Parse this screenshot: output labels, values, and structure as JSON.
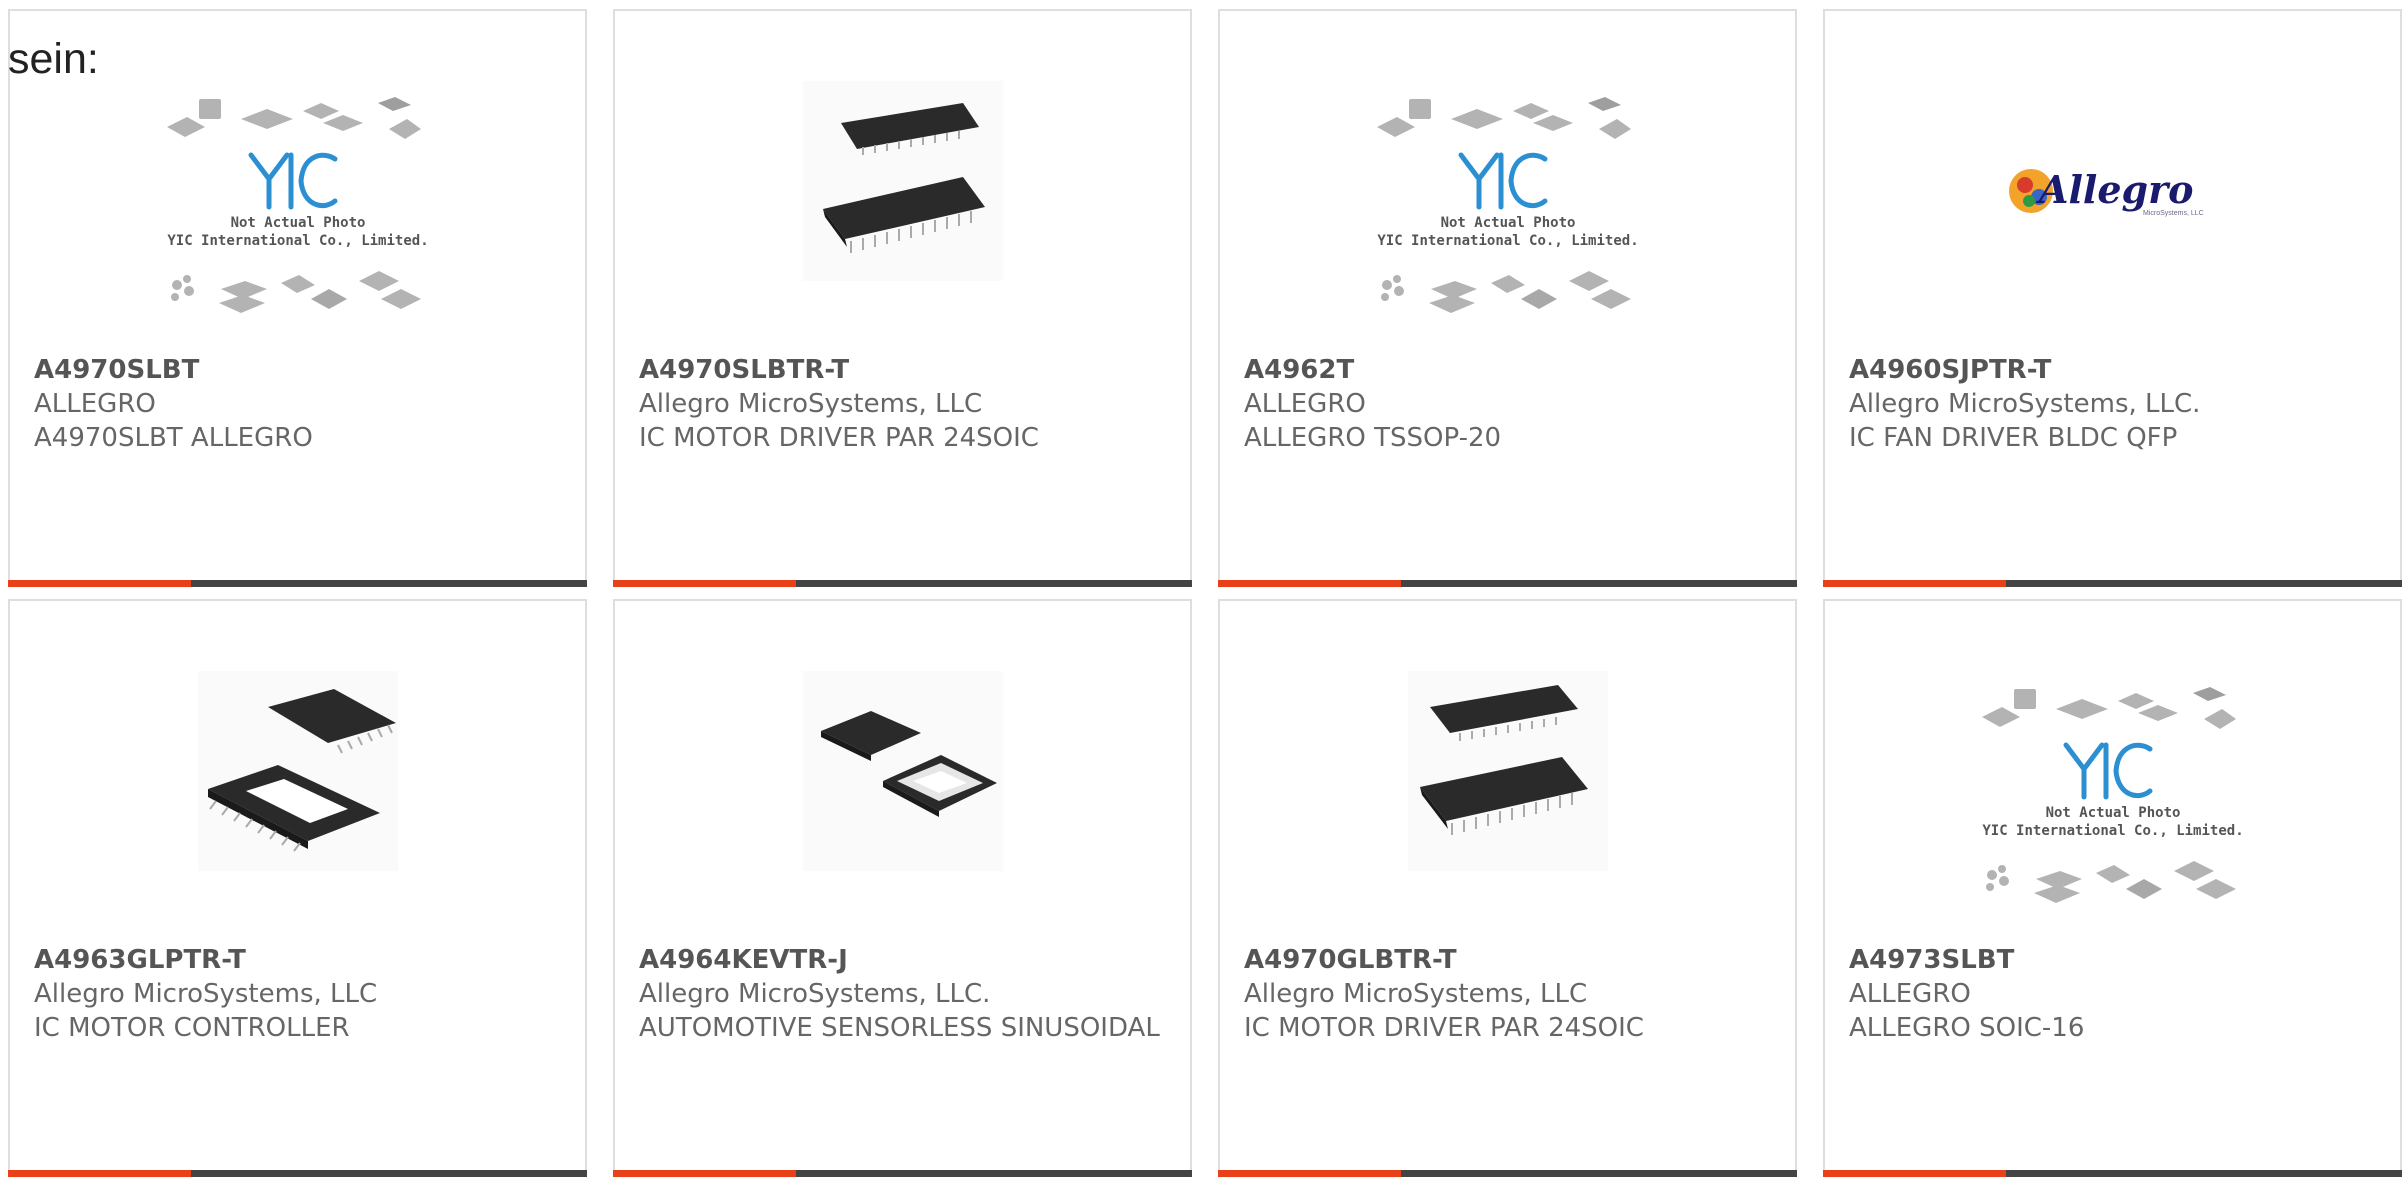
{
  "intro_text": "sein:",
  "products": [
    {
      "part": "A4970SLBT",
      "manufacturer": "ALLEGRO",
      "description": "A4970SLBT ALLEGRO",
      "image": "yic-placeholder"
    },
    {
      "part": "A4970SLBTR-T",
      "manufacturer": "Allegro MicroSystems, LLC",
      "description": "IC MOTOR DRIVER PAR 24SOIC",
      "image": "soic-24-chip"
    },
    {
      "part": "A4962T",
      "manufacturer": "ALLEGRO",
      "description": "ALLEGRO TSSOP-20",
      "image": "yic-placeholder"
    },
    {
      "part": "A4960SJPTR-T",
      "manufacturer": "Allegro MicroSystems, LLC.",
      "description": "IC FAN DRIVER BLDC QFP",
      "image": "allegro-logo"
    },
    {
      "part": "A4963GLPTR-T",
      "manufacturer": "Allegro MicroSystems, LLC",
      "description": "IC MOTOR CONTROLLER",
      "image": "tssop-chip"
    },
    {
      "part": "A4964KEVTR-J",
      "manufacturer": "Allegro MicroSystems, LLC.",
      "description": "AUTOMOTIVE SENSORLESS SINUSOIDAL",
      "image": "qfn-chip"
    },
    {
      "part": "A4970GLBTR-T",
      "manufacturer": "Allegro MicroSystems, LLC",
      "description": "IC MOTOR DRIVER PAR 24SOIC",
      "image": "soic-24-chip"
    },
    {
      "part": "A4973SLBT",
      "manufacturer": "ALLEGRO",
      "description": "ALLEGRO SOIC-16",
      "image": "yic-placeholder"
    }
  ],
  "placeholder": {
    "logo": "YIC",
    "line1": "Not Actual Photo",
    "line2": "YIC International Co., Limited."
  },
  "allegro_logo": {
    "word": "Allegro",
    "sub": "MicroSystems, LLC"
  },
  "colors": {
    "accent": "#e8401b",
    "bar": "#444444",
    "border": "#dedede",
    "text": "#666666"
  }
}
